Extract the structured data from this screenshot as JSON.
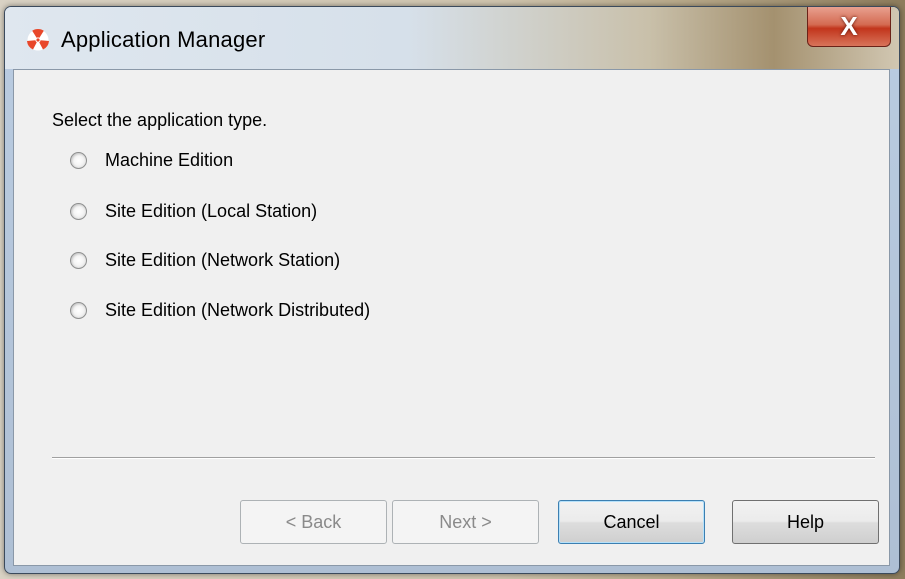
{
  "window": {
    "title": "Application Manager",
    "close_glyph": "X",
    "icon": "radiation-trefoil-icon"
  },
  "dialog": {
    "prompt": "Select the application type.",
    "options": [
      {
        "label": "Machine Edition",
        "selected": false
      },
      {
        "label": "Site Edition (Local Station)",
        "selected": false
      },
      {
        "label": "Site Edition (Network Station)",
        "selected": false
      },
      {
        "label": "Site Edition (Network Distributed)",
        "selected": false
      }
    ]
  },
  "buttons": {
    "back": {
      "label": "< Back",
      "enabled": false
    },
    "next": {
      "label": "Next >",
      "enabled": false
    },
    "cancel": {
      "label": "Cancel",
      "enabled": true
    },
    "help": {
      "label": "Help",
      "enabled": true
    }
  },
  "colors": {
    "icon_red": "#e8472a",
    "close_button": "#c2351c",
    "dialog_background": "#f0f0f0"
  }
}
